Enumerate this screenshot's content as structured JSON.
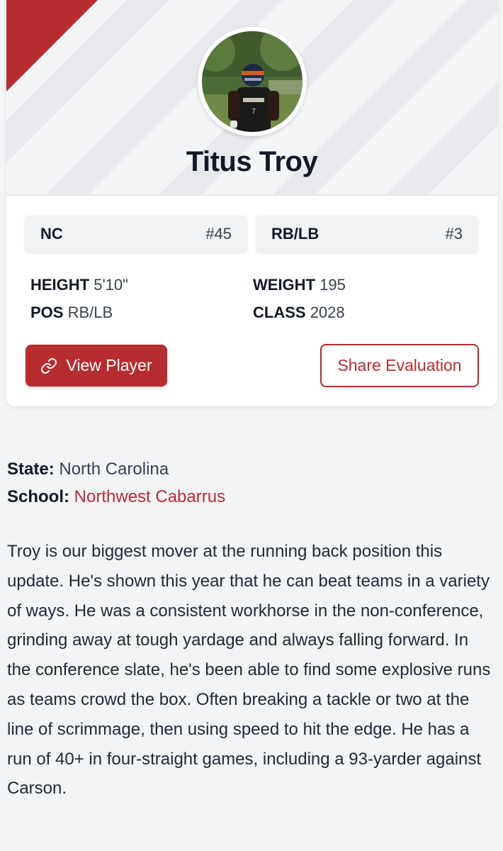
{
  "profile": {
    "name": "Titus Troy",
    "avatar_icon": "player-photo",
    "state_chip": {
      "label": "NC",
      "rank": "#45"
    },
    "position_chip": {
      "label": "RB/LB",
      "rank": "#3"
    },
    "stats": {
      "height_label": "HEIGHT",
      "height_value": "5'10\"",
      "weight_label": "WEIGHT",
      "weight_value": "195",
      "pos_label": "POS",
      "pos_value": "RB/LB",
      "class_label": "CLASS",
      "class_value": "2028"
    },
    "actions": {
      "view_player_label": "View Player",
      "view_player_icon": "link-icon",
      "share_label": "Share Evaluation"
    }
  },
  "details": {
    "state_label": "State:",
    "state_value": "North Carolina",
    "school_label": "School:",
    "school_value": "Northwest Cabarrus"
  },
  "bio": "Troy is our biggest mover at the running back position this update. He's shown this year that he can beat teams in a variety of ways. He was a consistent workhorse in the non-conference, grinding away at tough yardage and always falling forward. In the conference slate, he's been able to find some explosive runs as teams crowd the box. Often breaking a tackle or two at the line of scrimmage, then using speed to hit the edge. He has a run of 40+ in four-straight games, including a 93-yarder against Carson.",
  "colors": {
    "accent": "#b62c2f",
    "page_background": "#f3f4f6",
    "card_background": "#ffffff",
    "text_dark": "#111827"
  }
}
